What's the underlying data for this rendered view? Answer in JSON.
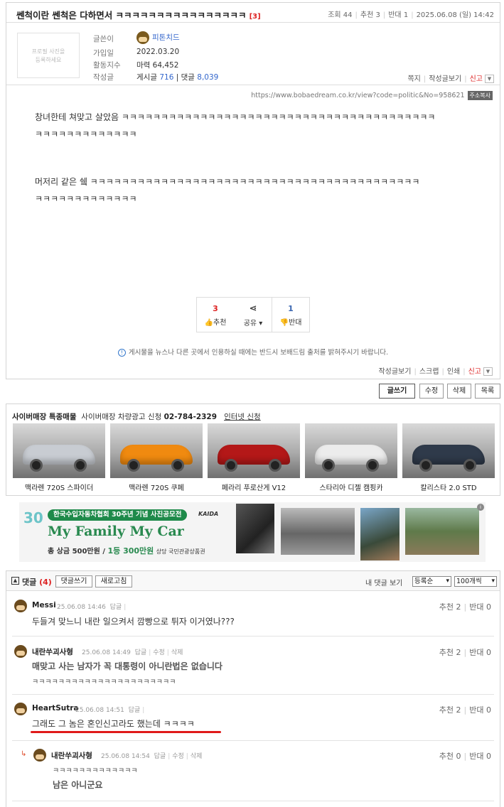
{
  "post": {
    "title": "쎈척이란 쎈척은 다하면서 ㅋㅋㅋㅋㅋㅋㅋㅋㅋㅋㅋㅋㅋㅋㅋㅋ",
    "comment_count": "[3]",
    "meta": {
      "views": "조회 44",
      "recommend": "추천 3",
      "oppose": "반대 1",
      "date": "2025.06.08 (일) 14:42"
    },
    "profile": {
      "photo_placeholder_1": "프로필 사진을",
      "photo_placeholder_2": "등록하세요",
      "labels": {
        "writer": "글쓴이",
        "joined": "가입일",
        "activity": "활동지수",
        "written": "작성글"
      },
      "writer": "피톤치드",
      "joined": "2022.03.20",
      "activity": "마력 64,452",
      "posts_label": "게시글",
      "posts": "716",
      "comments_label": "댓글",
      "comments": "8,039"
    },
    "profile_actions": {
      "note": "쪽지",
      "view_posts": "작성글보기",
      "report": "신고"
    },
    "url": "https://www.bobaedream.co.kr/view?code=politic&No=958621",
    "copy_url": "주소복사",
    "body": [
      "창녀한테 쳐맞고 살았음 ㅋㅋㅋㅋㅋㅋㅋㅋㅋㅋㅋㅋㅋㅋㅋㅋㅋㅋㅋㅋㅋㅋㅋㅋㅋㅋㅋㅋㅋㅋㅋㅋㅋㅋㅋㅋㅋㅋㅋㅋ",
      "ㅋㅋㅋㅋㅋㅋㅋㅋㅋㅋㅋㅋㅋ",
      "머저리 같은 쉨 ㅋㅋㅋㅋㅋㅋㅋㅋㅋㅋㅋㅋㅋㅋㅋㅋㅋㅋㅋㅋㅋㅋㅋㅋㅋㅋㅋㅋㅋㅋㅋㅋㅋㅋㅋㅋㅋㅋㅋㅋㅋㅋ",
      "ㅋㅋㅋㅋㅋㅋㅋㅋㅋㅋㅋㅋㅋ"
    ],
    "vote": {
      "up_count": "3",
      "up_label": "추천",
      "share_label": "공유",
      "down_count": "1",
      "down_label": "반대"
    },
    "notice": "게시물을 뉴스나 다른 곳에서 인용하실 때에는 반드시 보배드림 출처를 밝혀주시기 바랍니다.",
    "bottom_actions": {
      "view_posts": "작성글보기",
      "scrap": "스크랩",
      "print": "인쇄",
      "report": "신고"
    }
  },
  "buttons": {
    "write": "글쓰기",
    "edit": "수정",
    "delete": "삭제",
    "list": "목록"
  },
  "cyber": {
    "title": "사이버매장 특종매물",
    "sub": "사이버매장 차량광고 신청",
    "phone": "02-784-2329",
    "online": "인터넷 신청",
    "cars": [
      {
        "label": "맥라렌 720S 스파이더",
        "color": "#c8ccd2"
      },
      {
        "label": "맥라렌 720S 쿠페",
        "color": "#f08a10"
      },
      {
        "label": "페라리 푸로산게 V12",
        "color": "#b41818"
      },
      {
        "label": "스타리아 디젤 캠핑카",
        "color": "#ececec"
      },
      {
        "label": "칼리스타 2.0 STD",
        "color": "#2f3a4a"
      }
    ]
  },
  "ad": {
    "banner_title": "한국수입자동차협회 30주년 기념 사진공모전",
    "headline": "My Family My Car",
    "prize_a": "총 상금 500만원",
    "prize_b": "1등 300만원",
    "prize_c": "상당 국민관광상품권",
    "brand": "KAIDA",
    "logo": "30"
  },
  "comments": {
    "title": "댓글",
    "count": "(4)",
    "write_btn": "댓글쓰기",
    "refresh_btn": "새로고침",
    "my_comments": "내 댓글 보기",
    "sort": "등록순",
    "per_page": "100개씩",
    "items": [
      {
        "name": "Messi",
        "date": "25.06.08 14:46",
        "reply": "답글",
        "edit": "",
        "del": "",
        "up": "추천 2",
        "down": "반대 0",
        "lines": [
          "두들겨 맞느니 내란 일으켜서 깜빵으로 튀자 이거였나???"
        ]
      },
      {
        "name": "내란쑤괴사형",
        "date": "25.06.08 14:49",
        "reply": "답글",
        "edit": "수정",
        "del": "삭제",
        "up": "추천 2",
        "down": "반대 0",
        "lines": [
          "매맞고 사는 남자가 꼭 대통령이 아니란법은 없습니다",
          "ㅋㅋㅋㅋㅋㅋㅋㅋㅋㅋㅋㅋㅋㅋㅋㅋㅋㅋㅋㅋㅋㅋ"
        ]
      },
      {
        "name": "HeartSutra",
        "date": "25.06.08 14:51",
        "reply": "답글",
        "edit": "",
        "del": "",
        "up": "추천 2",
        "down": "반대 0",
        "lines": [
          "그래도 그 놈은 혼인신고라도 했는데 ㅋㅋㅋㅋ"
        ]
      },
      {
        "name": "내란쑤괴사형",
        "date": "25.06.08 14:54",
        "reply": "답글",
        "edit": "수정",
        "del": "삭제",
        "up": "추천 0",
        "down": "반대 0",
        "lines": [
          "ㅋㅋㅋㅋㅋㅋㅋㅋㅋㅋㅋㅋㅋ",
          "남은 아니군요"
        ]
      }
    ]
  }
}
